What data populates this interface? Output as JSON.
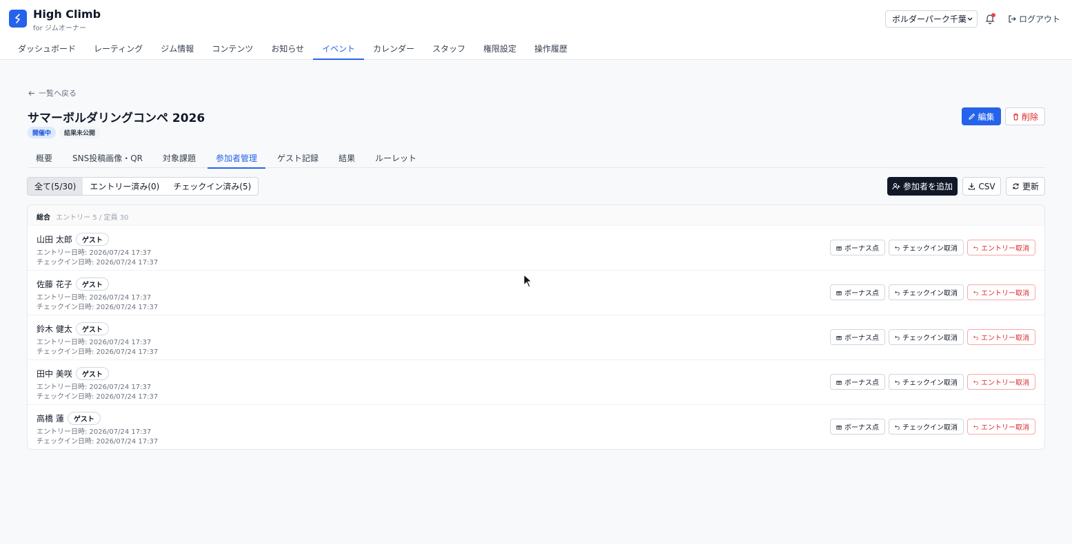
{
  "header": {
    "app_title": "High Climb",
    "app_subtitle": "for ジムオーナー",
    "gym_select_value": "ボルダーパーク千葉",
    "logout_label": "ログアウト"
  },
  "nav": [
    {
      "label": "ダッシュボード",
      "active": false
    },
    {
      "label": "レーティング",
      "active": false
    },
    {
      "label": "ジム情報",
      "active": false
    },
    {
      "label": "コンテンツ",
      "active": false
    },
    {
      "label": "お知らせ",
      "active": false
    },
    {
      "label": "イベント",
      "active": true
    },
    {
      "label": "カレンダー",
      "active": false
    },
    {
      "label": "スタッフ",
      "active": false
    },
    {
      "label": "権限設定",
      "active": false
    },
    {
      "label": "操作履歴",
      "active": false
    }
  ],
  "page": {
    "back_label": "一覧へ戻る",
    "title": "サマーボルダリングコンペ 2026",
    "status_badge": "開催中",
    "result_badge": "結果未公開",
    "edit_label": "編集",
    "delete_label": "削除"
  },
  "tabs": [
    {
      "label": "概要",
      "active": false
    },
    {
      "label": "SNS投稿画像・QR",
      "active": false
    },
    {
      "label": "対象課題",
      "active": false
    },
    {
      "label": "参加者管理",
      "active": true
    },
    {
      "label": "ゲスト記録",
      "active": false
    },
    {
      "label": "結果",
      "active": false
    },
    {
      "label": "ルーレット",
      "active": false
    }
  ],
  "filters": [
    {
      "label": "全て(5/30)",
      "active": true
    },
    {
      "label": "エントリー済み(0)",
      "active": false
    },
    {
      "label": "チェックイン済み(5)",
      "active": false
    }
  ],
  "toolbar": {
    "add_label": "参加者を追加",
    "csv_label": "CSV",
    "refresh_label": "更新"
  },
  "summary": {
    "label": "総合",
    "capacity_text": "エントリー 5 / 定員 30"
  },
  "participants": [
    {
      "name": "山田 太郎",
      "tag": "ゲスト",
      "entry": "エントリー日時: 2026/07/24 17:37",
      "checkin": "チェックイン日時: 2026/07/24 17:37"
    },
    {
      "name": "佐藤 花子",
      "tag": "ゲスト",
      "entry": "エントリー日時: 2026/07/24 17:37",
      "checkin": "チェックイン日時: 2026/07/24 17:37"
    },
    {
      "name": "鈴木 健太",
      "tag": "ゲスト",
      "entry": "エントリー日時: 2026/07/24 17:37",
      "checkin": "チェックイン日時: 2026/07/24 17:37"
    },
    {
      "name": "田中 美咲",
      "tag": "ゲスト",
      "entry": "エントリー日時: 2026/07/24 17:37",
      "checkin": "チェックイン日時: 2026/07/24 17:37"
    },
    {
      "name": "高橋 蓮",
      "tag": "ゲスト",
      "entry": "エントリー日時: 2026/07/24 17:37",
      "checkin": "チェックイン日時: 2026/07/24 17:37"
    }
  ],
  "row_actions": {
    "bonus_label": "ボーナス点",
    "cancel_checkin_label": "チェックイン取消",
    "cancel_entry_label": "エントリー取消"
  },
  "colors": {
    "accent": "#2563eb",
    "danger": "#dc2626",
    "dark": "#111827"
  }
}
